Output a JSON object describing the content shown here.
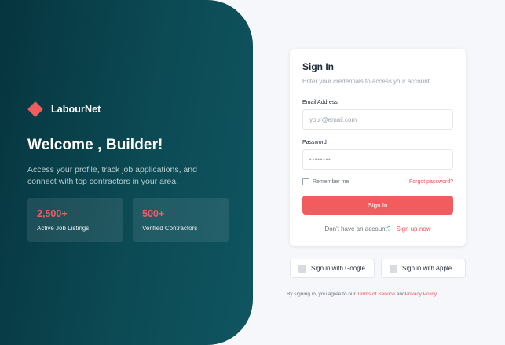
{
  "hero": {
    "brand": "LabourNet",
    "title": "Welcome , Builder!",
    "description": "Access your profile, track job applications, and connect with top contractors in your area.",
    "stats": [
      {
        "value": "2,500+",
        "label": "Active Job Listings"
      },
      {
        "value": "500+",
        "label": "Verified Contractors"
      }
    ]
  },
  "signin": {
    "title": "Sign In",
    "subtitle": "Enter your credentials to access your account",
    "email_label": "Email Address",
    "email_placeholder": "your@email.com",
    "password_label": "Password",
    "password_value": "••••••••",
    "remember_label": "Remember me",
    "forgot_label": "Forgot password?",
    "submit_label": "Sign In",
    "signup_prompt": "Don't have an account?",
    "signup_link": "Sign up now"
  },
  "social": {
    "google_label": "Sign in with Google",
    "apple_label": "Sign in with Apple"
  },
  "terms": {
    "prefix": "By signing in, you agree to our",
    "tos_link": "Terms of Service",
    "and": "and",
    "privacy_link": "Privacy Policy"
  },
  "colors": {
    "accent": "#f25c5f",
    "hero_bg": "#0c4a54",
    "page_bg": "#f5f7fa"
  }
}
